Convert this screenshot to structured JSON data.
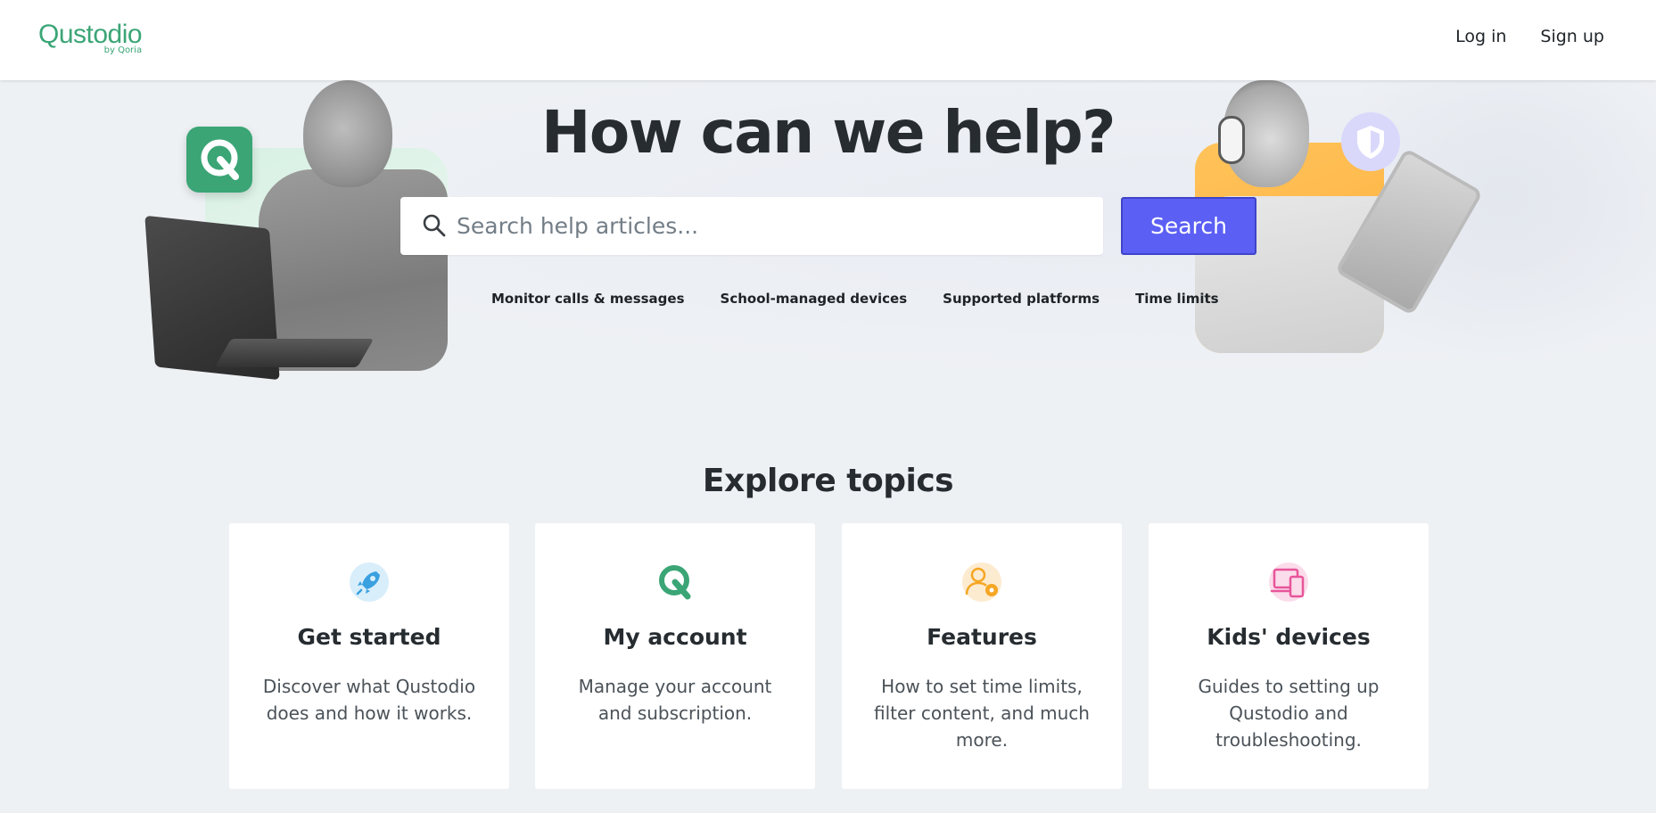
{
  "header": {
    "logo_text": "Qustodio",
    "logo_sub": "by Qoria",
    "nav": {
      "login": "Log in",
      "signup": "Sign up"
    }
  },
  "hero": {
    "title": "How can we help?",
    "search": {
      "placeholder": "Search help articles...",
      "button": "Search"
    },
    "quick_links": [
      "Monitor calls & messages",
      "School-managed devices",
      "Supported platforms",
      "Time limits"
    ]
  },
  "topics": {
    "title": "Explore topics",
    "cards": [
      {
        "icon": "rocket-icon",
        "title": "Get started",
        "desc": "Discover what Qustodio does and how it works."
      },
      {
        "icon": "qustodio-logo-icon",
        "title": "My account",
        "desc": "Manage your account and subscription."
      },
      {
        "icon": "user-settings-icon",
        "title": "Features",
        "desc": "How to set time limits, filter content, and much more."
      },
      {
        "icon": "devices-icon",
        "title": "Kids' devices",
        "desc": "Guides to setting up Qustodio and troubleshooting."
      }
    ]
  },
  "colors": {
    "brand_green": "#3ba576",
    "search_button": "#5b5ff4",
    "background": "#eef1f4",
    "heading": "#262c30"
  }
}
